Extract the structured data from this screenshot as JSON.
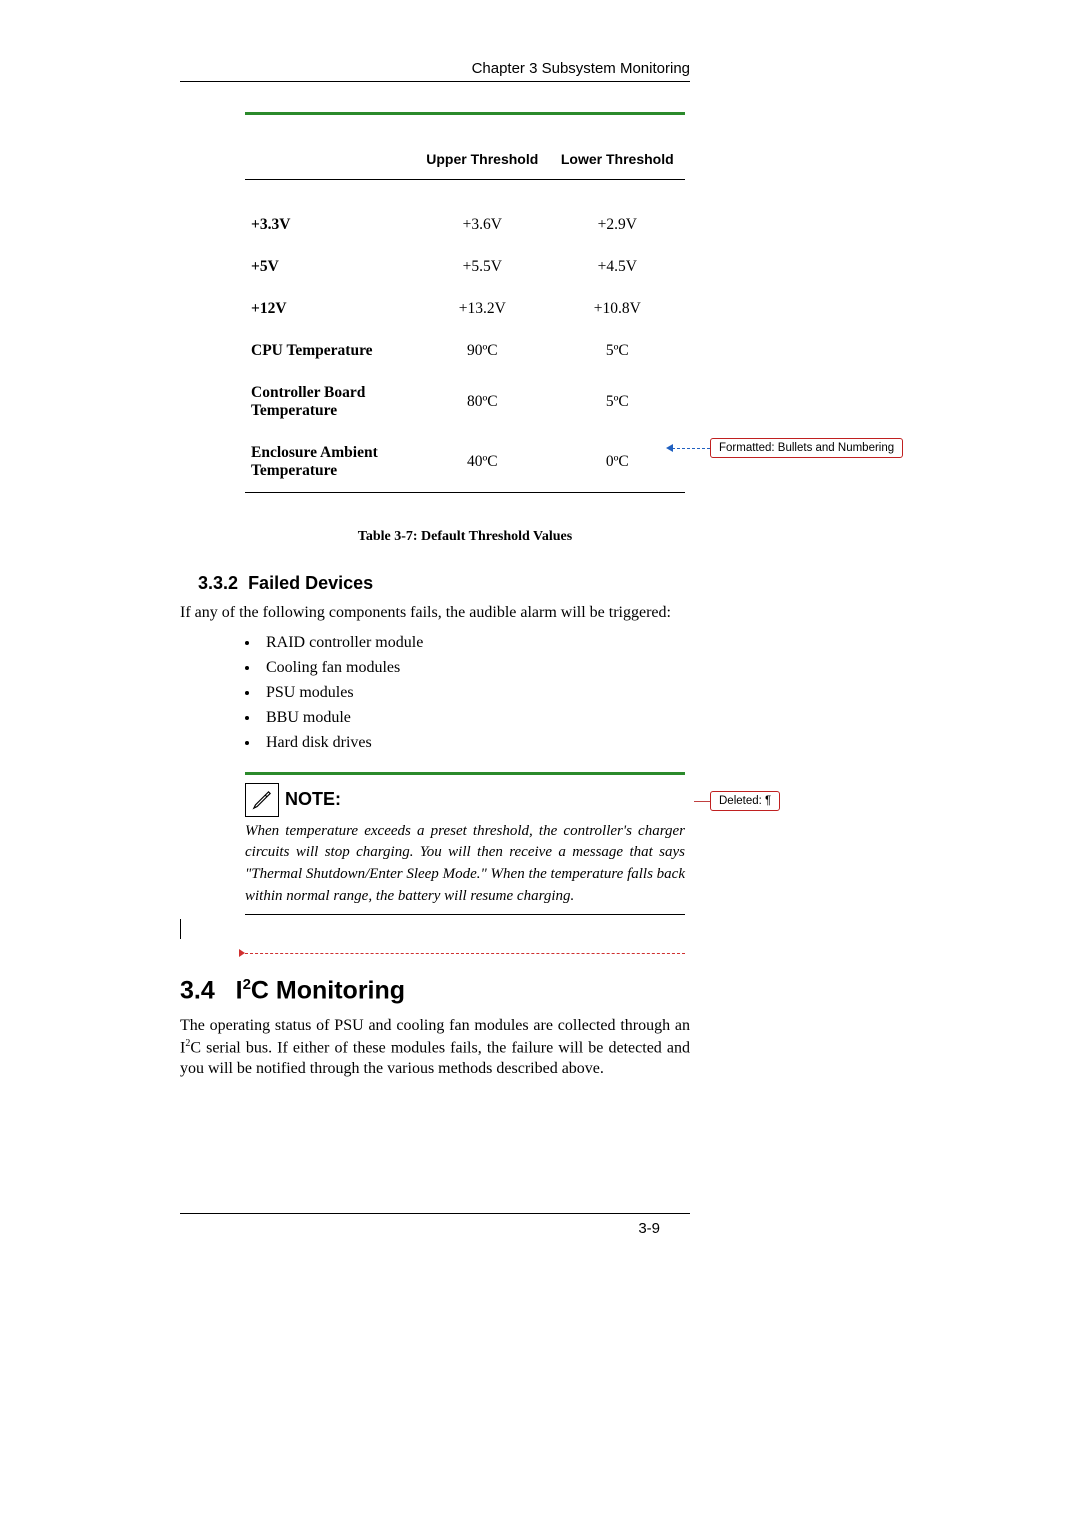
{
  "header": {
    "chapter": "Chapter 3 Subsystem Monitoring"
  },
  "table": {
    "headers": [
      "",
      "Upper Threshold",
      "Lower Threshold"
    ],
    "rows": [
      {
        "label": "+3.3V",
        "upper": "+3.6V",
        "lower": "+2.9V"
      },
      {
        "label": "+5V",
        "upper": "+5.5V",
        "lower": "+4.5V"
      },
      {
        "label": "+12V",
        "upper": "+13.2V",
        "lower": "+10.8V"
      },
      {
        "label": "CPU Temperature",
        "upper": "90ºC",
        "lower": "5ºC"
      },
      {
        "label": "Controller Board Temperature",
        "upper": "80ºC",
        "lower": "5ºC"
      },
      {
        "label": "Enclosure Ambient Temperature",
        "upper": "40ºC",
        "lower": "0ºC"
      }
    ],
    "caption": "Table 3-7: Default Threshold Values"
  },
  "section_332": {
    "number": "3.3.2",
    "title": "Failed Devices",
    "intro": "If any of the following components fails, the audible alarm will be triggered:",
    "items": [
      "RAID controller module",
      "Cooling fan modules",
      "PSU modules",
      "BBU module",
      "Hard disk drives"
    ]
  },
  "note": {
    "label": "NOTE:",
    "body": "When temperature exceeds a preset threshold, the controller's charger circuits will stop charging. You will then receive a message that says \"Thermal Shutdown/Enter Sleep Mode.\" When the temperature falls back within normal range, the battery will resume charging."
  },
  "section_34": {
    "number": "3.4",
    "title_html": "I²C Monitoring",
    "body": "The operating status of PSU and cooling fan modules are collected through an I²C serial bus. If either of these modules fails, the failure will be detected and you will be notified through the various methods described above."
  },
  "comments": {
    "formatted": "Formatted: Bullets and Numbering",
    "deleted": "Deleted: ¶"
  },
  "footer": {
    "page": "3-9"
  }
}
